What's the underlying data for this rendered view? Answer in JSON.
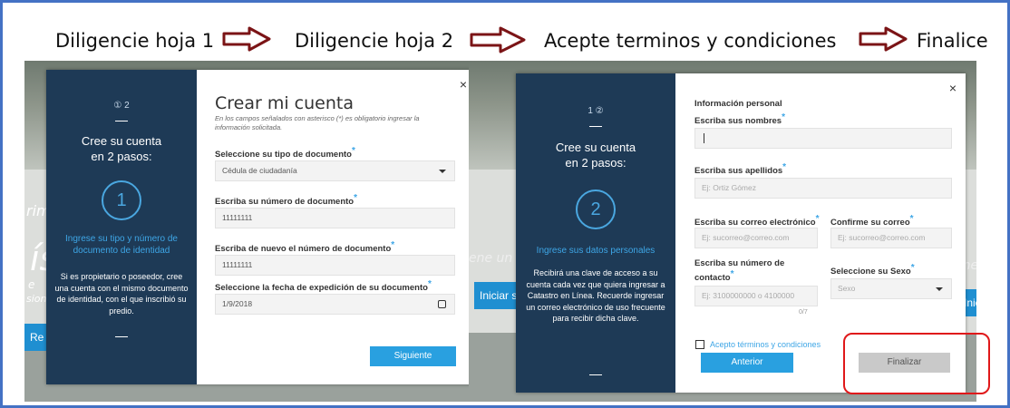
{
  "steps": {
    "step1": "Diligencie hoja 1",
    "step2": "Diligencie hoja 2",
    "step3": "Acepte terminos y condiciones",
    "step4": "Finalice"
  },
  "colors": {
    "sidebar": "#1e3a56",
    "accent": "#29a0e0",
    "highlight": "#e0181a",
    "arrow": "#7b1416"
  },
  "background": {
    "left_texts": [
      "rim",
      "ís",
      "e",
      "sion",
      "Re"
    ],
    "center_text": "ene un",
    "center_button": "Iniciar s",
    "right_texts": [
      "ene",
      "Inic"
    ]
  },
  "modal1": {
    "pager": "① 2",
    "side_heading": "Cree su cuenta\nen 2 pasos:",
    "step_number": "1",
    "side_hint": "Ingrese su tipo y número de documento de identidad",
    "side_desc": "Si es propietario o poseedor, cree una cuenta con el mismo documento de identidad, con el que inscribió su predio.",
    "close": "×",
    "title": "Crear mi cuenta",
    "subtitle": "En los campos señalados con asterisco (*) es obligatorio ingresar la información solicitada.",
    "doc_type_label": "Seleccione su tipo de documento",
    "doc_type_value": "Cédula de ciudadanía",
    "doc_number_label": "Escriba su número de documento",
    "doc_number_value": "11111111",
    "doc_repeat_label": "Escriba de nuevo el número de documento",
    "doc_repeat_value": "11111111",
    "date_label": "Seleccione la fecha de expedición de su documento",
    "date_value": "1/9/2018",
    "next_button": "Siguiente",
    "asterisk": "*"
  },
  "modal2": {
    "pager": "1 ②",
    "side_heading": "Cree su cuenta\nen 2 pasos:",
    "step_number": "2",
    "side_hint": "Ingrese sus datos personales",
    "side_desc": "Recibirá una clave de acceso a su cuenta cada vez que quiera ingresar a Catastro en Línea. Recuerde ingresar un correo electrónico de uso frecuente para recibir dicha clave.",
    "close": "×",
    "section_title": "Información personal",
    "names_label": "Escriba sus nombres",
    "names_value": "",
    "surnames_label": "Escriba sus apellidos",
    "surnames_placeholder": "Ej: Ortiz Gómez",
    "email_label": "Escriba su correo electrónico",
    "email_placeholder": "Ej: sucorreo@correo.com",
    "email_confirm_label": "Confirme su correo",
    "email_confirm_placeholder": "Ej: sucorreo@correo.com",
    "phone_label": "Escriba su número de contacto",
    "phone_placeholder": "Ej: 3100000000 o 4100000",
    "phone_counter": "0/7",
    "sex_label": "Seleccione su Sexo",
    "sex_placeholder": "Sexo",
    "terms_label": "Acepto términos y condiciones",
    "back_button": "Anterior",
    "finish_button": "Finalizar",
    "asterisk": "*"
  }
}
